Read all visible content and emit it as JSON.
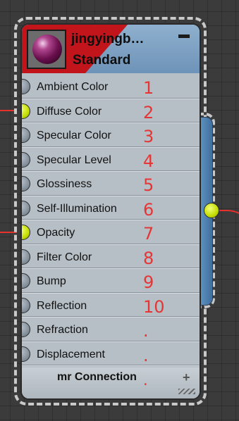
{
  "node": {
    "name": "jingyingb…",
    "type": "Standard",
    "footer_label": "mr Connection",
    "footer_marker": ".",
    "thumbnail": "material-sphere-purple"
  },
  "slots": [
    {
      "label": "Ambient Color",
      "number": "1",
      "connected": false
    },
    {
      "label": "Diffuse Color",
      "number": "2",
      "connected": true
    },
    {
      "label": "Specular Color",
      "number": "3",
      "connected": false
    },
    {
      "label": "Specular Level",
      "number": "4",
      "connected": false
    },
    {
      "label": "Glossiness",
      "number": "5",
      "connected": false
    },
    {
      "label": "Self-Illumination",
      "number": "6",
      "connected": false
    },
    {
      "label": "Opacity",
      "number": "7",
      "connected": true
    },
    {
      "label": "Filter Color",
      "number": "8",
      "connected": false
    },
    {
      "label": "Bump",
      "number": "9",
      "connected": false
    },
    {
      "label": "Reflection",
      "number": "10",
      "connected": false
    },
    {
      "label": "Refraction",
      "number": ".",
      "connected": false
    },
    {
      "label": "Displacement",
      "number": ".",
      "connected": false
    }
  ],
  "icons": {
    "collapse": "minus-icon",
    "expand": "plus-icon",
    "resize": "resize-grip-icon"
  },
  "colors": {
    "header_blue": "#7a9dc2",
    "header_red": "#c2141b",
    "socket_connected": "#c4dd00",
    "socket_idle": "#7e8b97",
    "wire": "#e8312a",
    "annotation": "#e53535"
  }
}
